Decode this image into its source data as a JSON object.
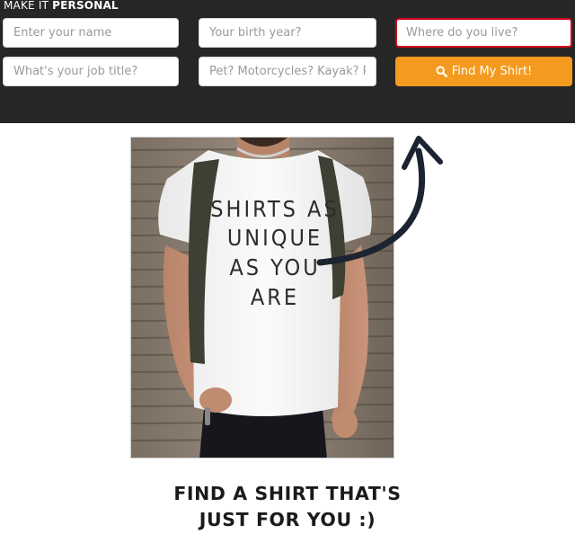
{
  "panel": {
    "title_light": "MAKE IT ",
    "title_bold": "PERSONAL"
  },
  "form": {
    "name_placeholder": "Enter your name",
    "birth_year_placeholder": "Your birth year?",
    "location_placeholder": "Where do you live?",
    "job_placeholder": "What's your job title?",
    "interests_placeholder": "Pet? Motorcycles? Kayak? Photography?",
    "submit_label": "Find My Shirt!",
    "submit_icon": "search-icon"
  },
  "hero": {
    "shirt_text": [
      "SHIRTS AS",
      "UNIQUE",
      "AS YOU",
      "ARE"
    ]
  },
  "headline": {
    "line1": "FIND A SHIRT THAT'S",
    "line2": "JUST FOR YOU :)"
  },
  "colors": {
    "panel_bg": "#262626",
    "button_bg": "#f39a1f",
    "active_border": "#d0021b",
    "headline_text": "#1a1a1a"
  }
}
